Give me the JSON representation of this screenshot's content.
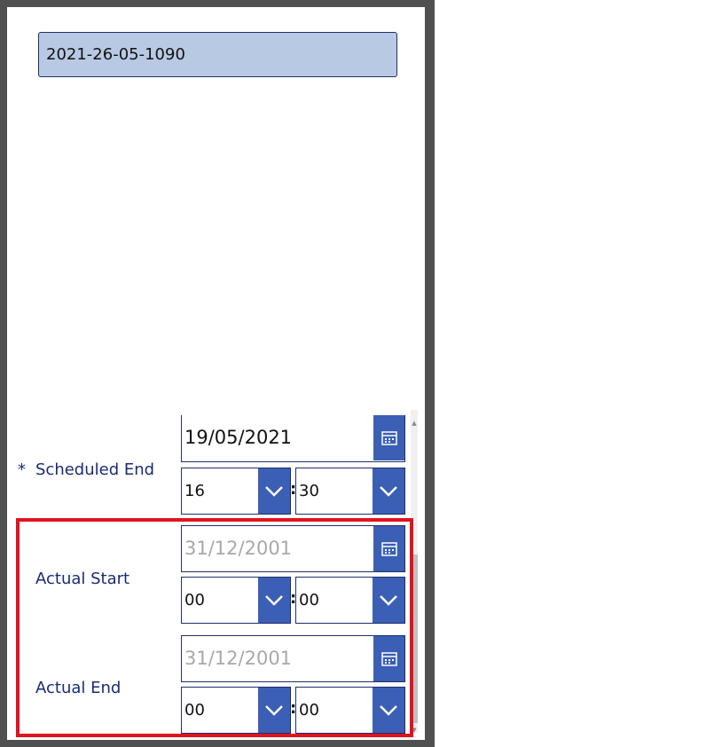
{
  "record": {
    "id": "2021-26-05-1090"
  },
  "scheduled_end": {
    "required_marker": "*",
    "label": "Scheduled End",
    "date": "19/05/2021",
    "hour": "16",
    "minute": "30"
  },
  "actual_start": {
    "label": "Actual Start",
    "date_placeholder": "31/12/2001",
    "hour": "00",
    "minute": "00"
  },
  "actual_end": {
    "label": "Actual End",
    "date_placeholder": "31/12/2001",
    "hour": "00",
    "minute": "00"
  },
  "time_separator": ":",
  "icons": {
    "calendar": "calendar-icon",
    "dropdown": "chevron-down-icon"
  },
  "colors": {
    "accent": "#3b5fb5",
    "label": "#1a2a78",
    "highlight": "#e0141f",
    "id_field": "#b8c9e3"
  }
}
